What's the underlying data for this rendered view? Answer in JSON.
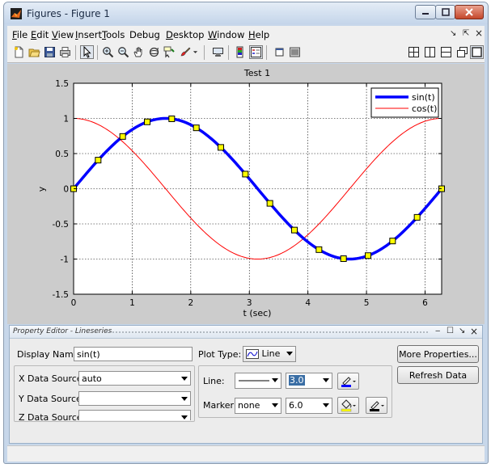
{
  "window": {
    "title": "Figures - Figure 1"
  },
  "menu": {
    "items": [
      {
        "label": "File",
        "u": "F",
        "rest": "ile"
      },
      {
        "label": "Edit",
        "u": "E",
        "rest": "dit"
      },
      {
        "label": "View",
        "u": "V",
        "rest": "iew"
      },
      {
        "label": "Insert",
        "u": "I",
        "rest": "nsert"
      },
      {
        "label": "Tools",
        "u": "T",
        "rest": "ools"
      },
      {
        "label": "Debug",
        "u": "",
        "rest": "Debug"
      },
      {
        "label": "Desktop",
        "u": "D",
        "rest": "esktop"
      },
      {
        "label": "Window",
        "u": "W",
        "rest": "indow"
      },
      {
        "label": "Help",
        "u": "H",
        "rest": "elp"
      }
    ],
    "dock_glyph": "↘",
    "pin_glyph": "⇱",
    "close_glyph": "×"
  },
  "chart_data": {
    "type": "line",
    "title": "Test 1",
    "xlabel": "t (sec)",
    "ylabel": "y",
    "xlim": [
      0,
      6.2832
    ],
    "ylim": [
      -1.5,
      1.5
    ],
    "xticks": [
      0,
      1,
      2,
      3,
      4,
      5,
      6
    ],
    "yticks": [
      -1.5,
      -1,
      -0.5,
      0,
      0.5,
      1,
      1.5
    ],
    "ytick_labels": [
      "-1.5",
      "-1",
      "-0.5",
      "0",
      "0.5",
      "1",
      "1.5"
    ],
    "grid": true,
    "legend": "top-right",
    "series": [
      {
        "name": "sin(t)",
        "function": "sin",
        "color": "#0000ff",
        "width": "thick",
        "marker": "square",
        "marker_color": "#ffff00",
        "marker_edge": "#000000",
        "marker_count": 16
      },
      {
        "name": "cos(t)",
        "function": "cos",
        "color": "#ff0000",
        "width": "thin",
        "marker": "none"
      }
    ]
  },
  "property_editor": {
    "title": "Property Editor - Lineseries",
    "controls": {
      "minimize": "‒",
      "undock": "☐",
      "pin": "↘",
      "close": "×"
    },
    "display_name_label": "Display Name:",
    "display_name_value": "sin(t)",
    "plot_type_label": "Plot Type:",
    "plot_type_value": "Line",
    "more_properties": "More Properties...",
    "refresh_data": "Refresh Data",
    "x_source_label": "X Data Source:",
    "x_source_value": "auto",
    "y_source_label": "Y Data Source:",
    "y_source_value": "",
    "z_source_label": "Z Data Source:",
    "z_source_value": "",
    "line_label": "Line:",
    "line_width": "3.0",
    "marker_label": "Marker:",
    "marker_value": "none",
    "marker_size": "6.0"
  },
  "colors": {
    "line_color": "#0000ff",
    "marker_face": "#ffff00",
    "marker_edge": "#000000"
  }
}
